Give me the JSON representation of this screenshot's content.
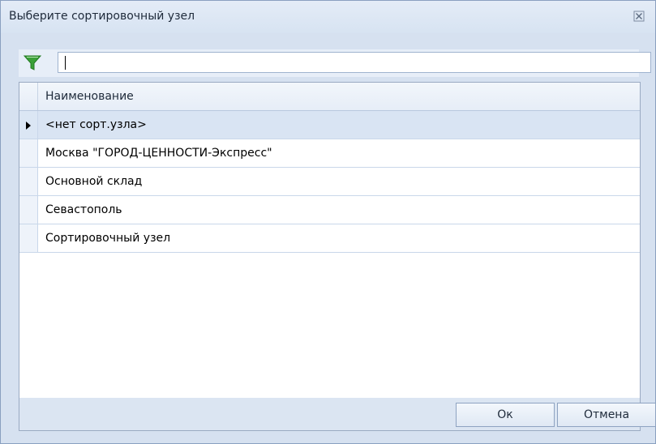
{
  "window": {
    "title": "Выберите сортировочный узел",
    "close_icon": "close-icon"
  },
  "filter": {
    "icon": "filter-icon",
    "value": ""
  },
  "grid": {
    "column_header": "Наименование",
    "selected_row_index": 0,
    "rows": [
      "<нет сорт.узла>",
      "Москва \"ГОРОД-ЦЕННОСТИ-Экспресс\"",
      "Основной склад",
      "Севастополь",
      "Сортировочный узел"
    ]
  },
  "buttons": {
    "ok_label": "Ок",
    "cancel_label": "Отмена"
  },
  "colors": {
    "accent": "#d9e4f3",
    "filter_icon": "#3aa038"
  }
}
